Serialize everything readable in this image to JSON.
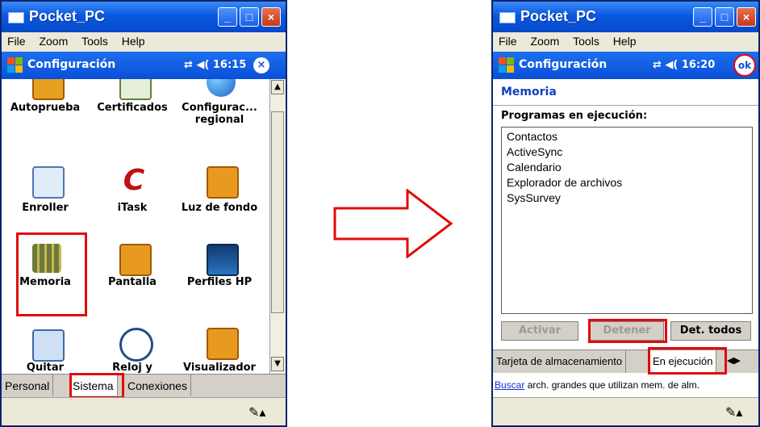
{
  "left": {
    "window_title": "Pocket_PC",
    "menu": [
      "File",
      "Zoom",
      "Tools",
      "Help"
    ],
    "panel_title": "Configuración",
    "time": "16:15",
    "close_glyph": "×",
    "items": [
      {
        "label": "Autoprueba",
        "icon": "autoprueba-icon"
      },
      {
        "label": "Certificados",
        "icon": "certificados-icon"
      },
      {
        "label": "Configurac... regional",
        "icon": "globe-icon"
      },
      {
        "label": "Enroller",
        "icon": "hp-enroller-icon"
      },
      {
        "label": "iTask",
        "icon": "itask-icon"
      },
      {
        "label": "Luz de fondo",
        "icon": "backlight-icon"
      },
      {
        "label": "Memoria",
        "icon": "memory-icon"
      },
      {
        "label": "Pantalla",
        "icon": "screen-icon"
      },
      {
        "label": "Perfiles HP",
        "icon": "hp-profiles-icon"
      },
      {
        "label": "Quitar",
        "icon": "remove-programs-icon"
      },
      {
        "label": "Reloj y",
        "icon": "clock-icon"
      },
      {
        "label": "Visualizador",
        "icon": "viewer-icon"
      }
    ],
    "tabs": [
      "Personal",
      "Sistema",
      "Conexiones"
    ]
  },
  "right": {
    "window_title": "Pocket_PC",
    "menu": [
      "File",
      "Zoom",
      "Tools",
      "Help"
    ],
    "panel_title": "Configuración",
    "time": "16:20",
    "ok_label": "ok",
    "section": "Memoria",
    "programs_label": "Programas en ejecución:",
    "programs": [
      "Contactos",
      "ActiveSync",
      "Calendario",
      "Explorador de archivos",
      "SysSurvey"
    ],
    "buttons": {
      "activate": "Activar",
      "stop": "Detener",
      "stop_all": "Det. todos"
    },
    "tabs": [
      "Tarjeta de almacenamiento",
      "En ejecución"
    ],
    "link_word": "Buscar",
    "link_rest": " arch. grandes que utilizan mem. de alm."
  },
  "colors": {
    "highlight": "#e10b0b",
    "titlebar": "#0a58e0"
  }
}
